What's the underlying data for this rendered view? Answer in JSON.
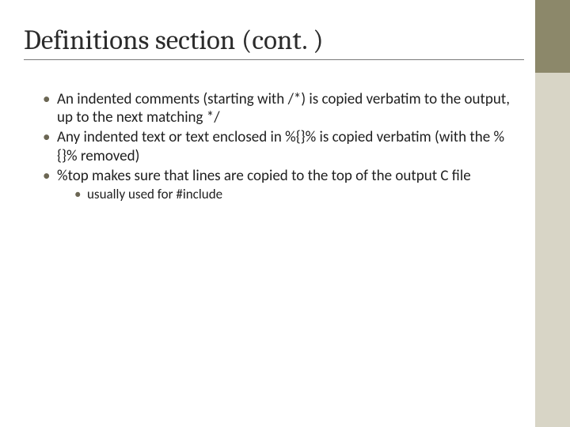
{
  "title": "Definitions section (cont. )",
  "bullets": [
    {
      "text": "An indented comments (starting with /*) is copied verbatim to the output, up to the next matching */"
    },
    {
      "text": "Any indented text or text enclosed in %{}% is copied verbatim (with the  %{}% removed)"
    },
    {
      "text": "%top makes sure that lines are copied to the top of the output C file",
      "sub": [
        {
          "text": "usually used for #include"
        }
      ]
    }
  ]
}
